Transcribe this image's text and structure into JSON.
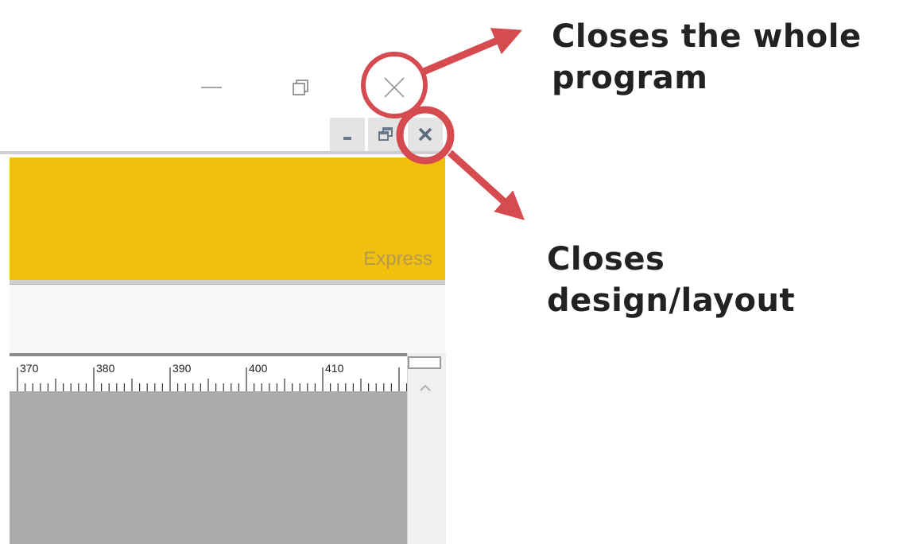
{
  "window_controls": {
    "minimize_icon": "minimize-icon",
    "restore_icon": "restore-icon",
    "close_icon": "close-icon"
  },
  "mdi_controls": {
    "minimize_icon": "minimize-icon",
    "restore_icon": "restore-icon",
    "close_icon": "close-icon"
  },
  "banner": {
    "product_label": "Express",
    "color": "#f0c00c"
  },
  "ruler": {
    "labels": [
      "370",
      "380",
      "390",
      "400",
      "410"
    ]
  },
  "annotations": {
    "program_close_line1": "Closes the whole",
    "program_close_line2": "program",
    "layout_close": "Closes design/layout",
    "highlight_color": "#d64b4f"
  }
}
